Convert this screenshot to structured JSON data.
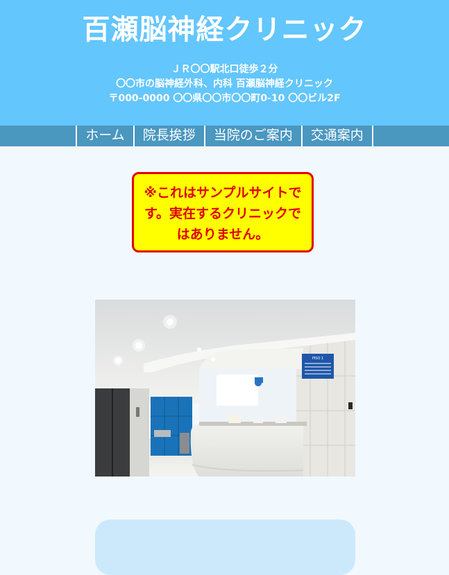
{
  "header": {
    "title": "百瀬脳神経クリニック",
    "access": "ＪＲ〇〇駅北口徒歩２分",
    "description": "〇〇市の脳神経外科、内科 百瀬脳神経クリニック",
    "address": "〒000-0000 〇〇県〇〇市〇〇町0-10 〇〇ビル2F"
  },
  "nav": {
    "items": [
      {
        "label": "ホーム"
      },
      {
        "label": "院長挨拶"
      },
      {
        "label": "当院のご案内"
      },
      {
        "label": "交通案内"
      }
    ]
  },
  "notice": {
    "text": "※これはサンプルサイトです。実在するクリニックではありません。"
  },
  "photo": {
    "sign_text": "PISO 1"
  },
  "colors": {
    "header_bg": "#63c6fc",
    "nav_bg": "#4a97c0",
    "page_bg": "#f1f9fe",
    "notice_bg": "#ffff00",
    "notice_border": "#e00000",
    "info_box_bg": "#cce9fc"
  }
}
